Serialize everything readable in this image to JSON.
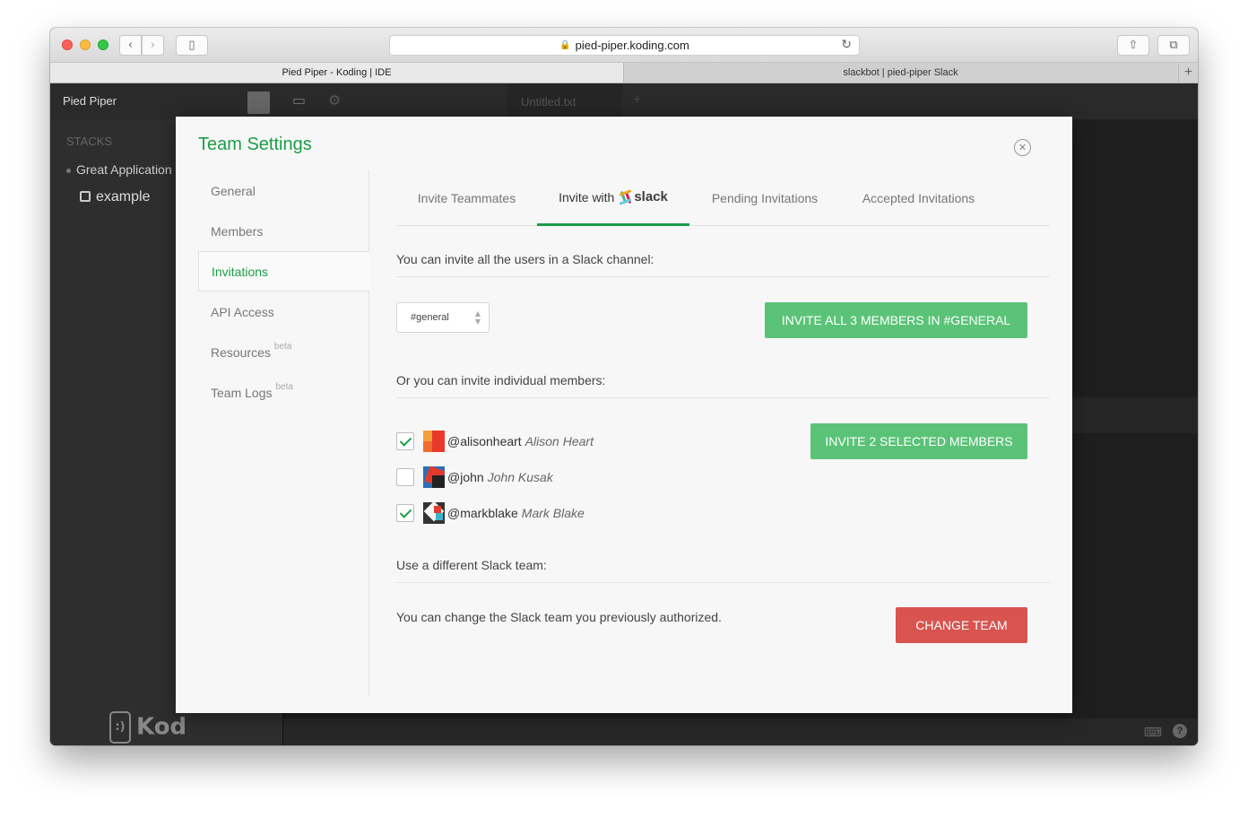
{
  "browser": {
    "url": "pied-piper.koding.com",
    "tabs": [
      {
        "label": "Pied Piper - Koding | IDE"
      },
      {
        "label": "slackbot | pied-piper Slack"
      }
    ]
  },
  "app": {
    "team_name": "Pied Piper",
    "editor_tab": "Untitled.txt",
    "sidebar": {
      "stacks_label": "STACKS",
      "stack_name": "Great Application",
      "machine_name": "example"
    },
    "logo_text": "Kod"
  },
  "modal": {
    "title": "Team Settings",
    "nav": [
      {
        "label": "General"
      },
      {
        "label": "Members"
      },
      {
        "label": "Invitations"
      },
      {
        "label": "API Access"
      },
      {
        "label": "Resources",
        "badge": "beta"
      },
      {
        "label": "Team Logs",
        "badge": "beta"
      }
    ],
    "tabs": {
      "invite_teammates": "Invite Teammates",
      "invite_with": "Invite with",
      "slack": "slack",
      "pending": "Pending Invitations",
      "accepted": "Accepted Invitations"
    },
    "channel_section": {
      "heading": "You can invite all the users in a Slack channel:",
      "selected_channel": "#general",
      "invite_all_label": "INVITE ALL 3 MEMBERS IN #GENERAL"
    },
    "individual_section": {
      "heading": "Or you can invite individual members:",
      "invite_selected_label": "INVITE 2 SELECTED MEMBERS",
      "members": [
        {
          "handle": "@alisonheart",
          "name": "Alison Heart",
          "checked": true
        },
        {
          "handle": "@john",
          "name": "John Kusak",
          "checked": false
        },
        {
          "handle": "@markblake",
          "name": "Mark Blake",
          "checked": true
        }
      ]
    },
    "team_section": {
      "heading": "Use a different Slack team:",
      "note": "You can change the Slack team you previously authorized.",
      "change_team_label": "CHANGE TEAM"
    }
  },
  "colors": {
    "accent_green": "#1c9d48",
    "button_green": "#5bc378",
    "button_red": "#d9534f"
  }
}
